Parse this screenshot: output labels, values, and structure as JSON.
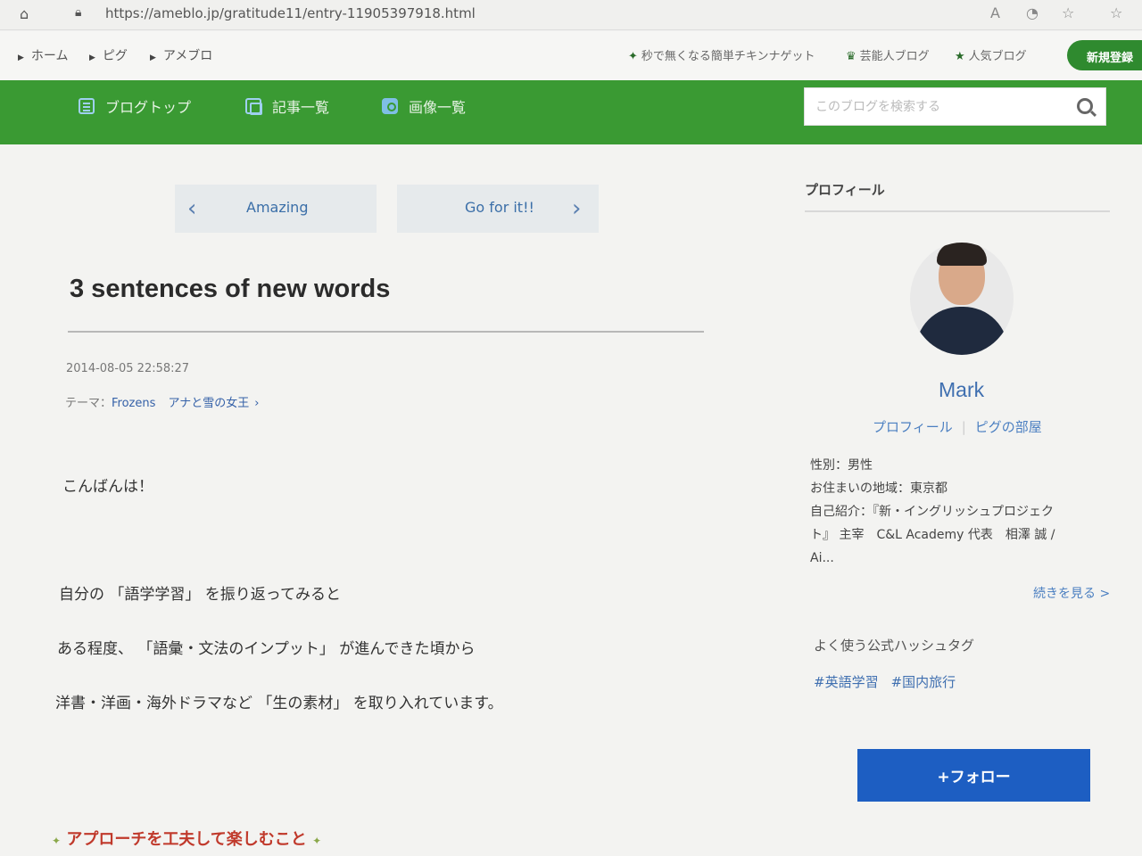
{
  "browser": {
    "url": "https://ameblo.jp/gratitude11/entry-11905397918.html",
    "icons": [
      "home-icon",
      "lock-icon",
      "read-aloud-icon",
      "extension-icon",
      "favorites-icon",
      "settings-icon"
    ]
  },
  "top_nav": {
    "breadcrumbs": [
      "ホーム",
      "ピグ",
      "アメブロ"
    ],
    "promos": [
      "秒で無くなる簡単チキンナゲット",
      "芸能人ブログ",
      "人気ブログ"
    ],
    "signup_label": "新規登録"
  },
  "blog_nav": {
    "items": [
      "ブログトップ",
      "記事一覧",
      "画像一覧"
    ],
    "search_placeholder": "このブログを検索する"
  },
  "pager": {
    "prev_label": "Amazing",
    "next_label": "Go for it!!"
  },
  "entry": {
    "title": "3 sentences of new words",
    "datetime": "2014-08-05 22:58:27",
    "theme_prefix": "テーマ：",
    "theme_name": "Frozens",
    "theme_sub": "アナと雪の女王",
    "paragraphs": [
      "こんばんは！",
      "自分の 「語学学習」 を振り返ってみると",
      "ある程度、 「語彙・文法のインプット」 が進んできた頃から",
      "洋書・洋画・海外ドラマなど 「生の素材」 を取り入れています。"
    ],
    "section_heading": "アプローチを工夫して楽しむこと"
  },
  "sidebar": {
    "title": "プロフィール",
    "name": "Mark",
    "links": [
      "プロフィール",
      "ピグの部屋"
    ],
    "info": {
      "gender": "性別：男性",
      "location": "お住まいの地域：東京都",
      "intro_line1": "自己紹介：『新・イングリッシュプロジェク",
      "intro_line2": "ト』 主宰　C&L Academy 代表　相澤 誠 /",
      "intro_line3": "Ai..."
    },
    "more_label": "続きを見る >",
    "hashtag_title": "よく使う公式ハッシュタグ",
    "hashtags": [
      "#英語学習",
      "#国内旅行"
    ],
    "follow_label": "+フォロー"
  },
  "colors": {
    "brand_green": "#3a9a33",
    "link_blue": "#3f6fb0",
    "follow_blue": "#1d5ec2",
    "heading_red": "#c0392b"
  }
}
